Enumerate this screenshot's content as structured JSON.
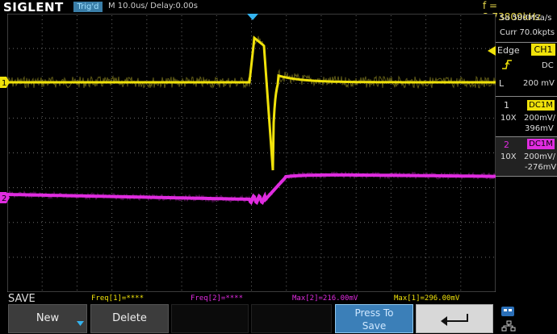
{
  "header": {
    "logo": "SIGLENT",
    "trig_status": "Trig'd",
    "timebase": "M 10.0us/  Delay:0.00s",
    "frequency": "f = 2.73809kHz"
  },
  "acquisition": {
    "sample_rate": "Sa 500MSa/s",
    "memory": "Curr 70.0kpts"
  },
  "trigger": {
    "type_label": "Edge",
    "source": "CH1",
    "slope_icon": "rising-edge-icon",
    "coupling": "DC",
    "level_prefix": "L",
    "level": "200 mV"
  },
  "channels": [
    {
      "number": "1",
      "coupling": "DC1M",
      "probe": "10X",
      "scale": "200mV/",
      "offset": "396mV",
      "color": "#f0e20a"
    },
    {
      "number": "2",
      "coupling": "DC1M",
      "probe": "10X",
      "scale": "200mV/",
      "offset": "-276mV",
      "color": "#e02ce0"
    }
  ],
  "channel_markers": {
    "ch1": "1",
    "ch2": "2"
  },
  "measurements": {
    "freq1": "Freq[1]=****",
    "freq2": "Freq[2]=****",
    "max2": "Max[2]=216.00mV",
    "max1": "Max[1]=296.00mV"
  },
  "softkeys": {
    "menu_title": "SAVE",
    "new_label": "New",
    "delete_label": "Delete",
    "press_line1": "Press To",
    "press_line2": "Save",
    "back_icon": "return-arrow-icon"
  },
  "colors": {
    "ch1": "#f0e20a",
    "ch2": "#e02ce0",
    "grid": "#505050",
    "accent": "#3b7fb8"
  }
}
